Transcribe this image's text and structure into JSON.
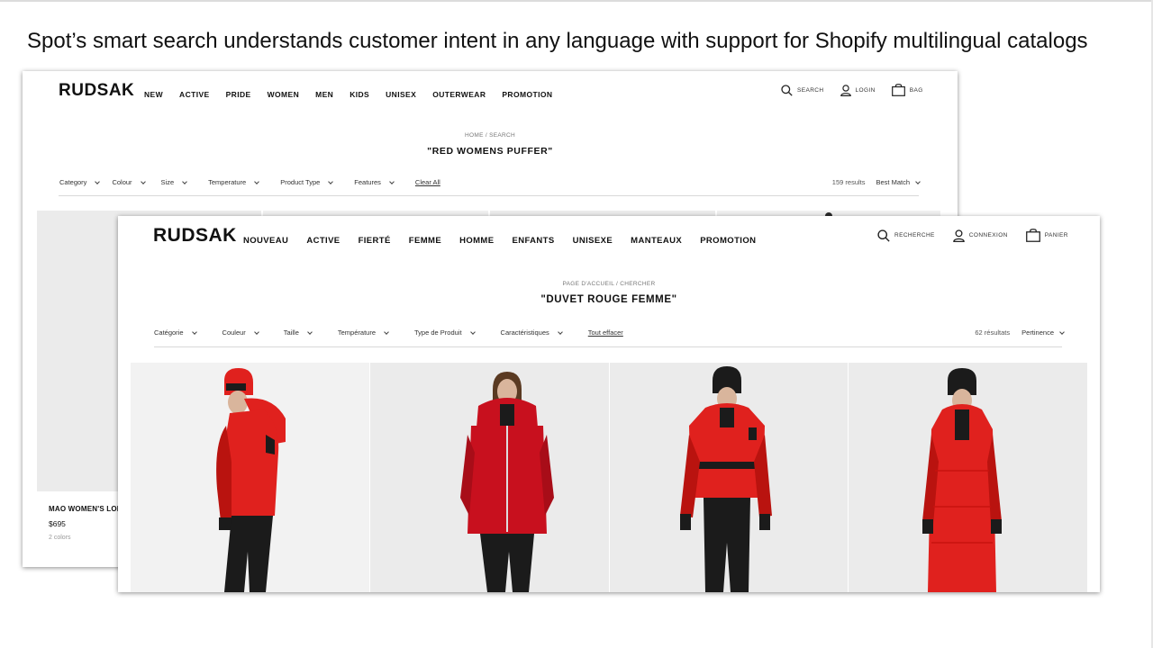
{
  "slide": {
    "headline": "Spot’s smart search understands customer intent in any language with support for Shopify multilingual catalogs"
  },
  "english_store": {
    "logo": "RUDSAK",
    "nav": [
      "NEW",
      "ACTIVE",
      "PRIDE",
      "WOMEN",
      "MEN",
      "KIDS",
      "UNISEX",
      "OUTERWEAR",
      "PROMOTION"
    ],
    "utilities": {
      "search": "SEARCH",
      "login": "LOGIN",
      "bag": "BAG"
    },
    "breadcrumb": "HOME / SEARCH",
    "query": "\"RED WOMENS PUFFER\"",
    "filters": [
      "Category",
      "Colour",
      "Size",
      "Temperature",
      "Product Type",
      "Features"
    ],
    "clear_all": "Clear All",
    "results_count": "159 results",
    "sort_label": "Best Match",
    "product": {
      "title": "MAO WOMEN'S LON",
      "price": "$695",
      "colors": "2 colors"
    }
  },
  "french_store": {
    "logo": "RUDSAK",
    "nav": [
      "NOUVEAU",
      "ACTIVE",
      "FIERTÉ",
      "FEMME",
      "HOMME",
      "ENFANTS",
      "UNISEXE",
      "MANTEAUX",
      "PROMOTION"
    ],
    "utilities": {
      "search": "RECHERCHE",
      "login": "CONNEXION",
      "bag": "PANIER"
    },
    "breadcrumb": "PAGE D'ACCUEIL / CHERCHER",
    "query": "\"DUVET ROUGE FEMME\"",
    "filters": [
      "Catégorie",
      "Couleur",
      "Taille",
      "Température",
      "Type de Produit",
      "Caractéristiques"
    ],
    "clear_all": "Tout effacer",
    "results_count": "62 résultats",
    "sort_label": "Pertinence"
  },
  "colors": {
    "jacket_red": "#e0211e",
    "jacket_shadow": "#b9130f",
    "legging_black": "#1b1b1b",
    "tile_gray": "#ebebeb",
    "skin": "#d9b59c"
  }
}
